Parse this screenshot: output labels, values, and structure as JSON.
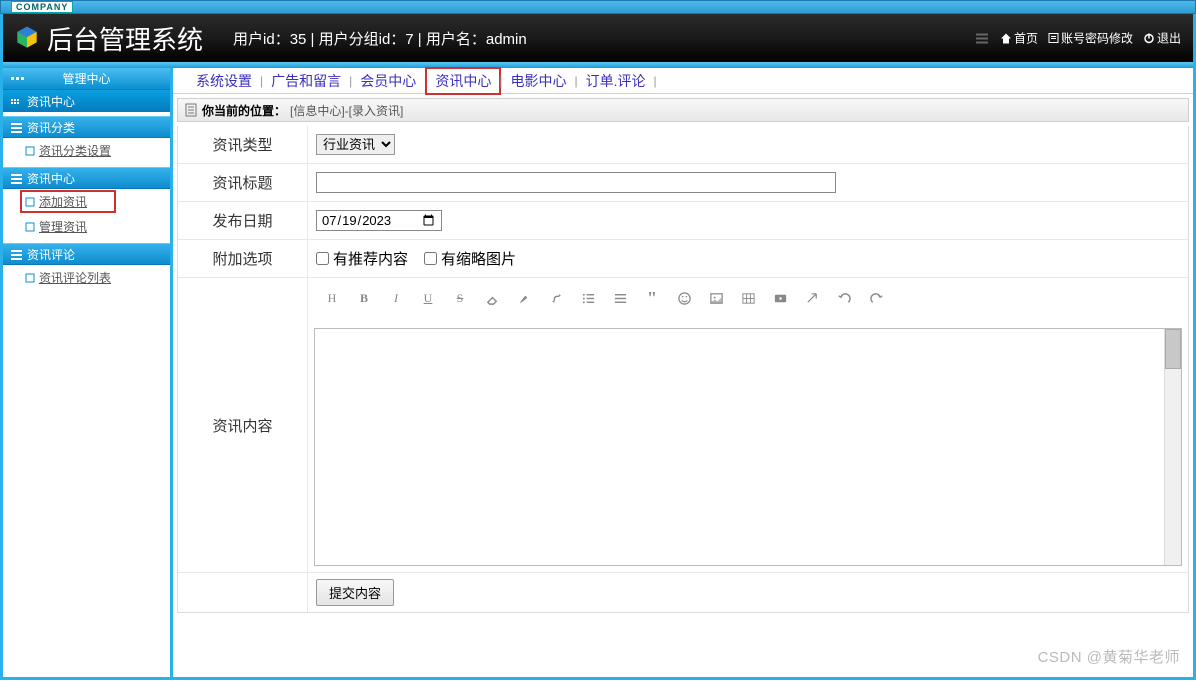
{
  "company_tag": "COMPANY",
  "header": {
    "title": "后台管理系统",
    "user_line": "用户id：35 | 用户分组id：7 | 用户名：admin",
    "links": {
      "home": "首页",
      "password": "账号密码修改",
      "logout": "退出"
    }
  },
  "sidebar": {
    "header": "管理中心",
    "crumb": "资讯中心",
    "groups": [
      {
        "title": "资讯分类",
        "items": [
          {
            "label": "资讯分类设置",
            "hl": false
          }
        ]
      },
      {
        "title": "资讯中心",
        "items": [
          {
            "label": "添加资讯",
            "hl": true
          },
          {
            "label": "管理资讯",
            "hl": false
          }
        ]
      },
      {
        "title": "资讯评论",
        "items": [
          {
            "label": "资讯评论列表",
            "hl": false
          }
        ]
      }
    ]
  },
  "tabs": [
    {
      "label": "系统设置",
      "active": false
    },
    {
      "label": "广告和留言",
      "active": false
    },
    {
      "label": "会员中心",
      "active": false
    },
    {
      "label": "资讯中心",
      "active": true
    },
    {
      "label": "电影中心",
      "active": false
    },
    {
      "label": "订单.评论",
      "active": false
    }
  ],
  "breadcrumb": {
    "prefix": "你当前的位置：",
    "path": "[信息中心]-[录入资讯]"
  },
  "form": {
    "type_label": "资讯类型",
    "type_value": "行业资讯",
    "title_label": "资讯标题",
    "title_value": "",
    "date_label": "发布日期",
    "date_value": "2023/07/19",
    "extra_label": "附加选项",
    "cb1": "有推荐内容",
    "cb2": "有缩略图片",
    "content_label": "资讯内容",
    "submit": "提交内容"
  },
  "editor_tools": [
    "heading",
    "bold",
    "italic",
    "underline",
    "strike",
    "erase",
    "brush",
    "link",
    "ul",
    "ol",
    "quote",
    "emoji",
    "image",
    "table",
    "video",
    "arrow",
    "undo",
    "redo"
  ],
  "watermark": "CSDN @黄菊华老师"
}
